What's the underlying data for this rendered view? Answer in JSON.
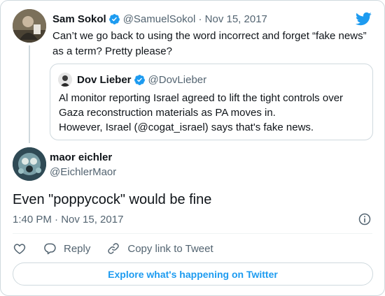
{
  "parent_tweet": {
    "name": "Sam Sokol",
    "handle_date": "@SamuelSokol · Nov 15, 2017",
    "text": "Can’t we go back to using the word incorrect and forget “fake news” as a term? Pretty please?"
  },
  "quoted_tweet": {
    "name": "Dov Lieber",
    "handle": "@DovLieber",
    "line1": "Al monitor reporting Israel agreed to lift the tight controls over",
    "line2": "Gaza reconstruction materials as PA moves in.",
    "line3": "However, Israel (@cogat_israel) says that's fake news."
  },
  "main_tweet": {
    "name": "maor eichler",
    "handle": "@EichlerMaor",
    "text": "Even \"poppycock\" would be fine",
    "timestamp": "1:40 PM · Nov 15, 2017"
  },
  "actions": {
    "reply_label": "Reply",
    "copy_link_label": "Copy link to Tweet"
  },
  "explore_label": "Explore what's happening on Twitter",
  "icons": [
    "verified-icon",
    "twitter-logo-icon",
    "info-icon",
    "heart-icon",
    "reply-icon",
    "link-icon"
  ],
  "colors": {
    "brand_blue": "#1d9bf0",
    "text": "#0f1419",
    "muted": "#536471",
    "border": "#cfd9de"
  }
}
